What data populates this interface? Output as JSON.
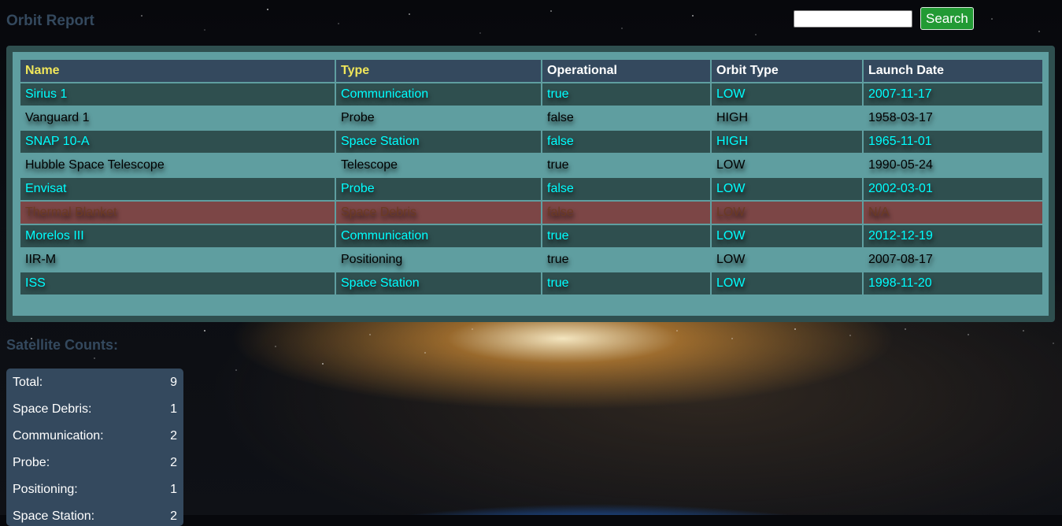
{
  "page": {
    "title": "Orbit Report"
  },
  "search": {
    "value": "",
    "placeholder": "",
    "button_label": "Search"
  },
  "table": {
    "headers": [
      "Name",
      "Type",
      "Operational",
      "Orbit Type",
      "Launch Date"
    ],
    "rows": [
      {
        "name": "Sirius 1",
        "type": "Communication",
        "operational": "true",
        "orbit": "LOW",
        "launch": "2007-11-17"
      },
      {
        "name": "Vanguard 1",
        "type": "Probe",
        "operational": "false",
        "orbit": "HIGH",
        "launch": "1958-03-17"
      },
      {
        "name": "SNAP 10-A",
        "type": "Space Station",
        "operational": "false",
        "orbit": "HIGH",
        "launch": "1965-11-01"
      },
      {
        "name": "Hubble Space Telescope",
        "type": "Telescope",
        "operational": "true",
        "orbit": "LOW",
        "launch": "1990-05-24"
      },
      {
        "name": "Envisat",
        "type": "Probe",
        "operational": "false",
        "orbit": "LOW",
        "launch": "2002-03-01"
      },
      {
        "name": "Thermal Blanket",
        "type": "Space Debris",
        "operational": "false",
        "orbit": "LOW",
        "launch": "N/A"
      },
      {
        "name": "Morelos III",
        "type": "Communication",
        "operational": "true",
        "orbit": "LOW",
        "launch": "2012-12-19"
      },
      {
        "name": "IIR-M",
        "type": "Positioning",
        "operational": "true",
        "orbit": "LOW",
        "launch": "2007-08-17"
      },
      {
        "name": "ISS",
        "type": "Space Station",
        "operational": "true",
        "orbit": "LOW",
        "launch": "1998-11-20"
      }
    ]
  },
  "counts": {
    "title": "Satellite Counts:",
    "items": [
      {
        "label": "Total:",
        "value": "9"
      },
      {
        "label": "Space Debris:",
        "value": "1"
      },
      {
        "label": "Communication:",
        "value": "2"
      },
      {
        "label": "Probe:",
        "value": "2"
      },
      {
        "label": "Positioning:",
        "value": "1"
      },
      {
        "label": "Space Station:",
        "value": "2"
      }
    ]
  },
  "colors": {
    "heading": "#34495e",
    "header_accent": "#f0e65a",
    "row_dark": "#2f4f4f",
    "row_light": "#5f9ea0",
    "row_debris": "#7c4646",
    "cyan_text": "#00ffff",
    "search_button": "#229a34"
  }
}
